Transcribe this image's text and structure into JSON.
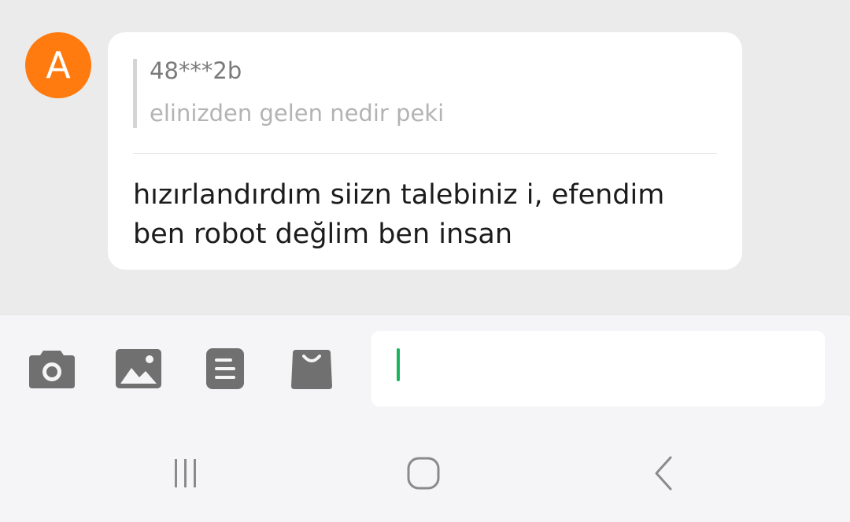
{
  "conversation": {
    "avatar_letter": "A",
    "avatar_color": "#ff7a0f",
    "message": {
      "quoted_user": "48***2b",
      "quoted_text": "elinizden gelen nedir peki",
      "text": "hızırlandırdım siizn talebiniz i, efendim ben robot değlim ben insan"
    }
  },
  "composer": {
    "tools": [
      "camera-icon",
      "gallery-icon",
      "document-icon",
      "shopping-bag-icon"
    ],
    "input_value": "",
    "cursor_color": "#19b55c"
  },
  "navigation": {
    "buttons": [
      "recent-apps-icon",
      "home-icon",
      "back-icon"
    ]
  }
}
